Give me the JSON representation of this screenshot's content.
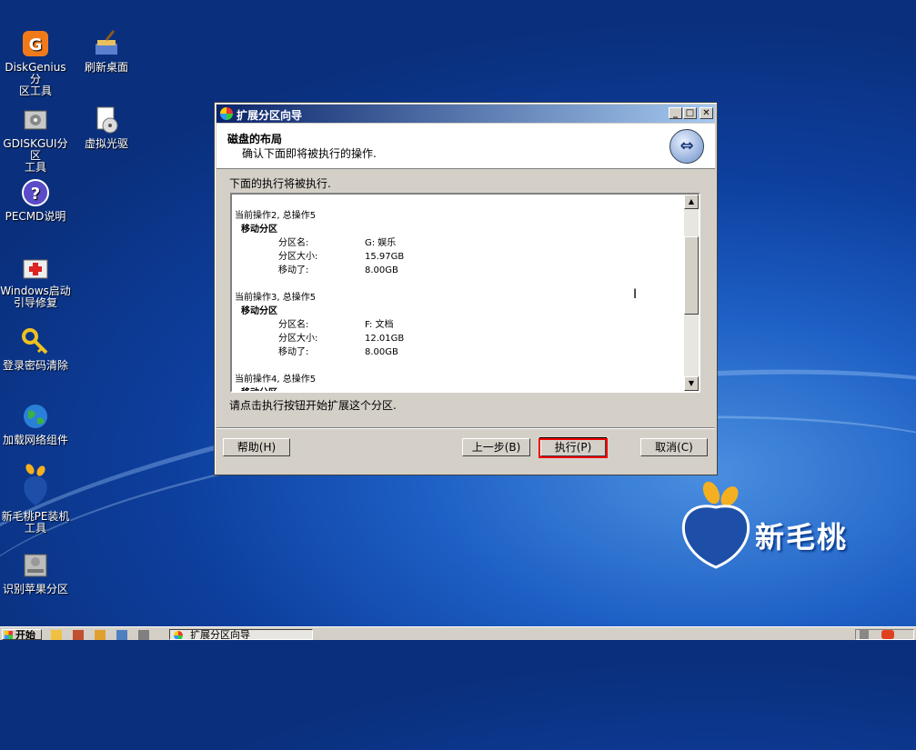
{
  "desktop": {
    "icons": [
      {
        "label": "DiskGenius分\n区工具"
      },
      {
        "label": "刷新桌面"
      },
      {
        "label": "GDISKGUI分区\n工具"
      },
      {
        "label": "虚拟光驱"
      },
      {
        "label": "PECMD说明"
      },
      {
        "label": "Windows启动\n引导修复"
      },
      {
        "label": "登录密码清除"
      },
      {
        "label": "加载网络组件"
      },
      {
        "label": "新毛桃PE装机\n工具"
      },
      {
        "label": "识别苹果分区"
      }
    ],
    "brand_text": "新毛桃"
  },
  "dialog": {
    "title": "扩展分区向导",
    "header_title": "磁盘的布局",
    "header_subtitle": "确认下面即将被执行的操作.",
    "intro": "下面的执行将被执行.",
    "operations": [
      {
        "op": "当前操作2, 总操作5",
        "action": "移动分区",
        "fields": [
          [
            "分区名:",
            "G: 娱乐"
          ],
          [
            "分区大小:",
            "15.97GB"
          ],
          [
            "移动了:",
            "8.00GB"
          ]
        ]
      },
      {
        "op": "当前操作3, 总操作5",
        "action": "移动分区",
        "fields": [
          [
            "分区名:",
            "F: 文档"
          ],
          [
            "分区大小:",
            "12.01GB"
          ],
          [
            "移动了:",
            "8.00GB"
          ]
        ]
      },
      {
        "op": "当前操作4, 总操作5",
        "action": "移动分区",
        "fields": []
      }
    ],
    "hint": "请点击执行按钮开始扩展这个分区.",
    "buttons": {
      "help": "帮助(H)",
      "back": "上一步(B)",
      "execute": "执行(P)",
      "cancel": "取消(C)"
    },
    "title_buttons": {
      "minimize": "_",
      "maximize": "□",
      "close": "✕"
    }
  },
  "taskbar": {
    "start": "开始",
    "task_label": "扩展分区向导"
  },
  "colors": {
    "title_start": "#0a246a",
    "title_end": "#a6caf0",
    "highlight": "#e00000"
  }
}
